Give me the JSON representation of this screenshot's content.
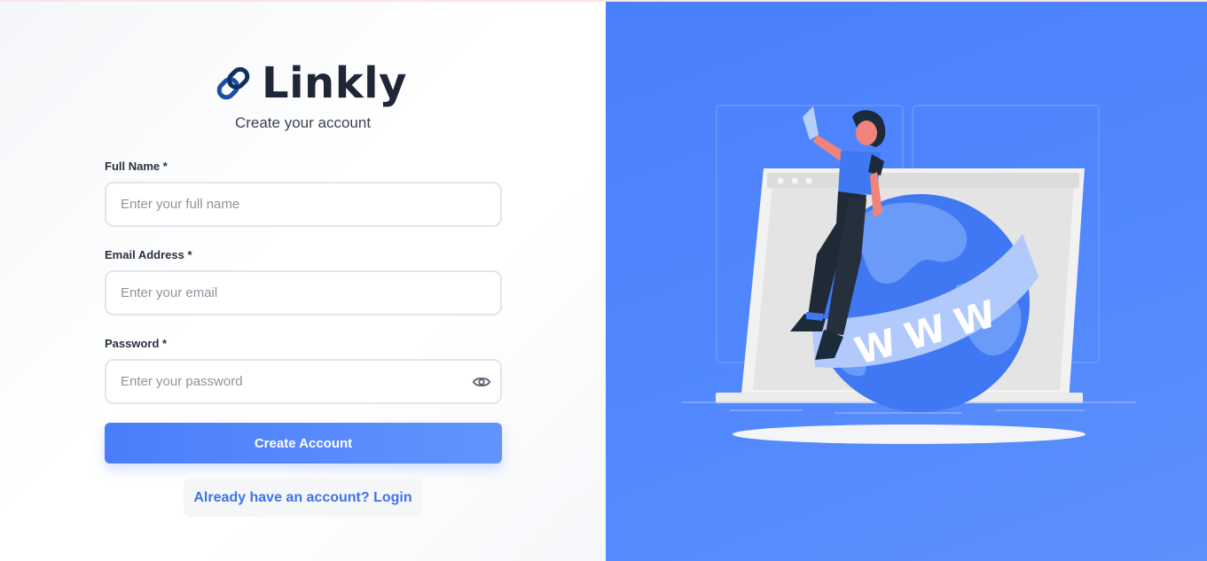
{
  "brand": {
    "name": "Linkly",
    "icon": "chain-link-icon"
  },
  "subtitle": "Create your account",
  "form": {
    "full_name": {
      "label": "Full Name *",
      "placeholder": "Enter your full name",
      "value": ""
    },
    "email": {
      "label": "Email Address *",
      "placeholder": "Enter your email",
      "value": ""
    },
    "password": {
      "label": "Password *",
      "placeholder": "Enter your password",
      "value": "",
      "toggle_icon": "eye-icon"
    },
    "submit_label": "Create Account",
    "login_link": "Already have an account? Login"
  },
  "illustration": {
    "globe_text": "WWW"
  },
  "colors": {
    "accent": "#4a7dfb",
    "panel": "#4f85fc",
    "link": "#3f73e6",
    "heading": "#1e2637"
  }
}
